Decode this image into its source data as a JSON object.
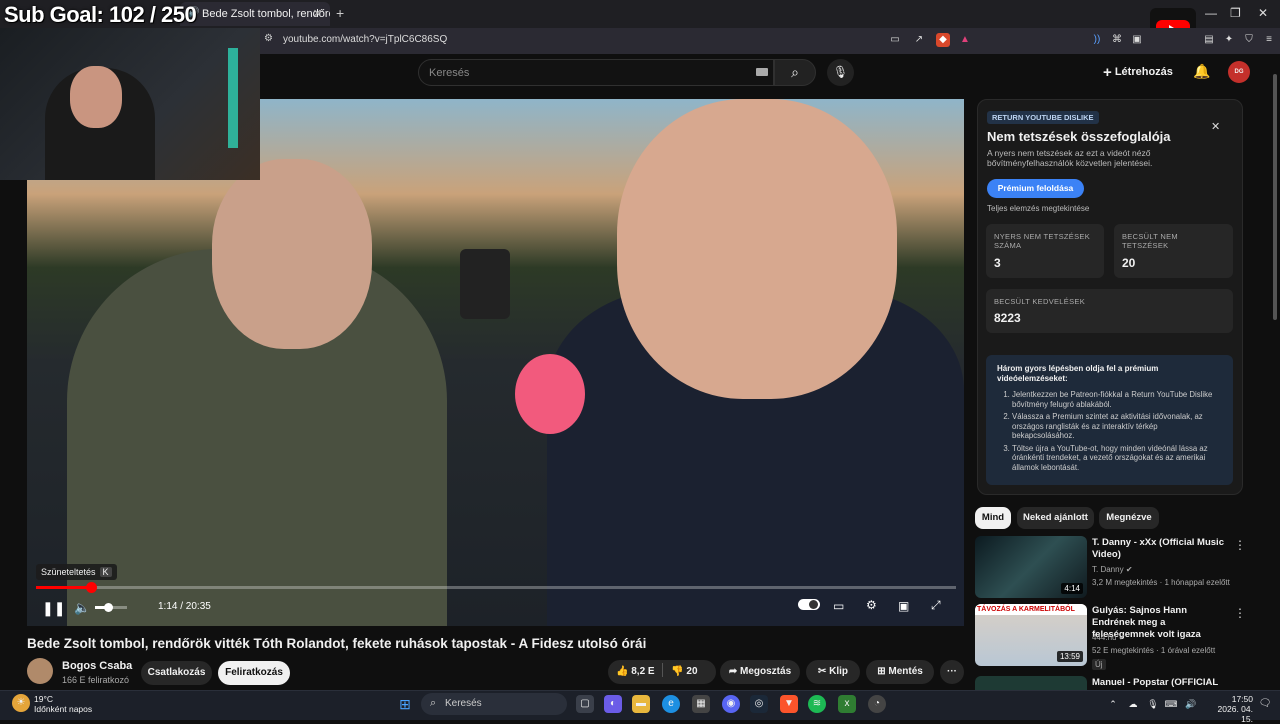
{
  "browser": {
    "tab_title": "Bede Zsolt tombol, rendőrök",
    "url": "youtube.com/watch?v=jTplC6C86SQ"
  },
  "overlay": {
    "sub_goal": "Sub Goal:  102  /  250"
  },
  "header": {
    "search_placeholder": "Keresés",
    "create_label": "Létrehozás",
    "avatar_text": "DG"
  },
  "player": {
    "pause_tooltip": "Szüneteltetés",
    "pause_key": "K",
    "time": "1:14 / 20:35",
    "progress": 0.06,
    "volume": 0.4
  },
  "video": {
    "title": "Bede Zsolt tombol, rendőrök vitték Tóth Rolandot, fekete ruhások tapostak - A Fidesz utolsó órái",
    "channel": "Bogos Csaba",
    "subscribers": "166 E feliratkozó",
    "join_label": "Csatlakozás",
    "subscribe_label": "Feliratkozás",
    "likes": "8,2 E",
    "dislikes": "20",
    "share_label": "Megosztás",
    "clip_label": "Klip",
    "save_label": "Mentés"
  },
  "ryd": {
    "badge": "RETURN YOUTUBE DISLIKE",
    "title": "Nem tetszések összefoglalója",
    "description": "A nyers nem tetszések az ezt a videót néző bővítményfelhasználók közvetlen jelentései.",
    "premium_button": "Prémium feloldása",
    "full_analysis": "Teljes elemzés megtekintése",
    "raw_dislikes_label": "NYERS NEM TETSZÉSEK SZÁMA",
    "raw_dislikes": "3",
    "est_dislikes_label": "BECSÜLT NEM TETSZÉSEK",
    "est_dislikes": "20",
    "est_likes_label": "BECSÜLT KEDVELÉSEK",
    "est_likes": "8223",
    "promo_heading": "Három gyors lépésben oldja fel a prémium videóelemzéseket:",
    "steps": [
      "Jelentkezzen be Patreon-fiókkal a Return YouTube Dislike bővítmény felugró ablakából.",
      "Válassza a Premium szintet az aktivitási idővonalak, az országos ranglisták és az interaktív térkép bekapcsolásához.",
      "Töltse újra a YouTube-ot, hogy minden videónál lássa az óránkénti trendeket, a vezető országokat és az amerikai államok lebontását."
    ]
  },
  "chips": [
    "Mind",
    "Neked ajánlott",
    "Megnézve"
  ],
  "related": [
    {
      "title": "T. Danny - xXx (Official Music Video)",
      "channel": "T. Danny",
      "meta": "3,2 M megtekintés · 1 hónappal ezelőtt",
      "duration": "4:14",
      "badge": ""
    },
    {
      "title": "Gulyás: Sajnos Hann Endrének meg a feleségemnek volt igaza",
      "channel": "444.hu",
      "meta": "52 E megtekintés · 1 órával ezelőtt",
      "duration": "13:59",
      "badge": "Új",
      "thumb_text": "TÁVOZÁS A KARMELITÁBÓL"
    },
    {
      "title": "Manuel - Popstar (OFFICIAL",
      "channel": "",
      "meta": "",
      "duration": "",
      "badge": ""
    }
  ],
  "taskbar": {
    "temp": "19°C",
    "weather": "Időnként napos",
    "search": "Keresés",
    "time": "17:50",
    "date": "2026. 04. 15."
  },
  "colors": {
    "accent": "#ff0000",
    "ryd_button": "#3b82f6",
    "bg": "#0f0f0f"
  }
}
